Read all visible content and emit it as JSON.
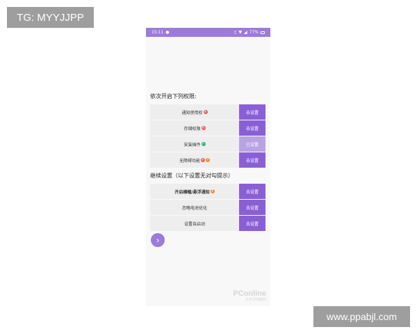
{
  "overlays": {
    "tag": "TG: MYYJJPP",
    "site": "www.ppabjl.com"
  },
  "statusbar": {
    "time": "15:11",
    "battery": "77%"
  },
  "section1": {
    "title": "依次开启下列权限:",
    "rows": [
      {
        "label": "通知使用权",
        "button": "去设置"
      },
      {
        "label": "存储权限",
        "button": "去设置"
      },
      {
        "label": "安装插件",
        "button": "已设置"
      },
      {
        "label": "无障碍功能",
        "button": "去设置"
      }
    ]
  },
  "section2": {
    "title": "继续设置（以下设置无对勾提示）",
    "rows": [
      {
        "label": "开启横幅/悬浮通知",
        "button": "去设置"
      },
      {
        "label": "忽略电池优化",
        "button": "去设置"
      },
      {
        "label": "设置自启动",
        "button": "去设置"
      }
    ]
  },
  "icons": {
    "next": "chevron-right-icon",
    "error": "x-circle-icon",
    "success": "check-circle-icon",
    "help": "question-circle-icon"
  },
  "colors": {
    "accent": "#8a5fd6",
    "accent_light": "#b9a3e3",
    "statusbar": "#9c7bd9",
    "error": "#e35d5d",
    "success": "#3bb37a",
    "help": "#f08a3a"
  },
  "watermark": {
    "brand": "PConline",
    "sub": "太平洋电脑网"
  }
}
